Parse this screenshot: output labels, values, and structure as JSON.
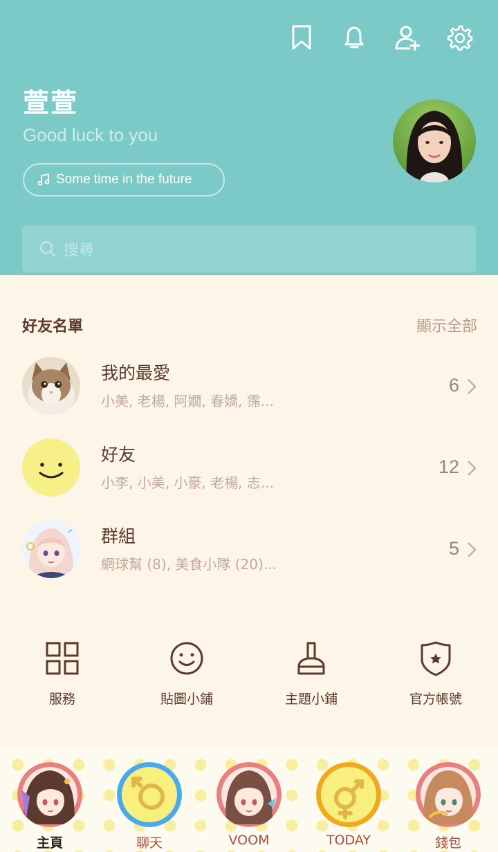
{
  "header": {
    "icons": [
      "bookmark-icon",
      "bell-icon",
      "add-friend-icon",
      "gear-icon"
    ],
    "username": "萱萱",
    "status_message": "Good luck to you",
    "music": "Some time in the future",
    "search_placeholder": "搜尋"
  },
  "friends": {
    "title": "好友名單",
    "show_all": "顯示全部",
    "groups": [
      {
        "name": "我的最愛",
        "members": "小美, 老楊, 阿嫺, 春嬌, 霈...",
        "count": "6"
      },
      {
        "name": "好友",
        "members": "小李, 小美, 小豪, 老楊, 志...",
        "count": "12"
      },
      {
        "name": "群組",
        "members": "網球幫 (8), 美食小隊 (20)...",
        "count": "5"
      }
    ]
  },
  "services": [
    {
      "label": "服務",
      "icon": "grid-icon"
    },
    {
      "label": "貼圖小鋪",
      "icon": "smiley-icon"
    },
    {
      "label": "主題小鋪",
      "icon": "brush-icon"
    },
    {
      "label": "官方帳號",
      "icon": "shield-star-icon"
    }
  ],
  "bottom_nav": [
    {
      "label": "主頁",
      "active": true
    },
    {
      "label": "聊天",
      "active": false
    },
    {
      "label": "VOOM",
      "active": false
    },
    {
      "label": "TODAY",
      "active": false
    },
    {
      "label": "錢包",
      "active": false
    }
  ],
  "colors": {
    "header_bg": "#7ccac8",
    "body_bg": "#fdf6e8",
    "text_brown": "#5a3a2e",
    "accent_label": "#a4503f"
  }
}
